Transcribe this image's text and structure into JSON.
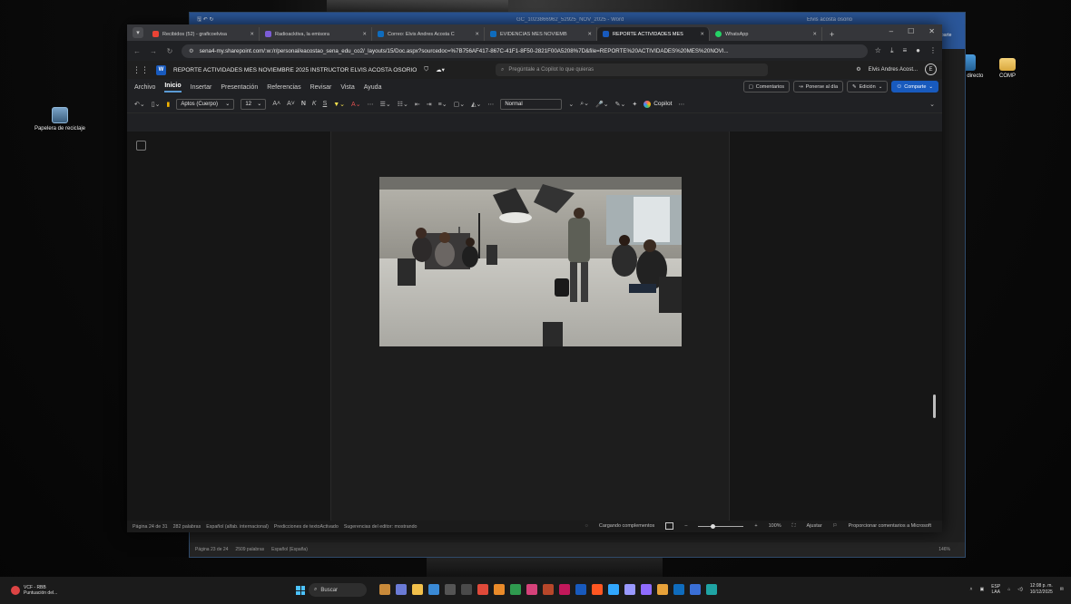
{
  "desktop": {
    "icons": [
      {
        "label": "Papelera de reciclaje"
      },
      {
        "label": "COMP"
      },
      {
        "label": "uipo - directo"
      }
    ]
  },
  "back_window": {
    "title": "GC_1023866962_52925_NOV_2025 - Word",
    "user": "Elvis acosta osorio",
    "status": [
      "Página 23 de 24",
      "2509 palabras",
      "Español (España)"
    ],
    "zoom": "146%",
    "share_fragment": "parte"
  },
  "browser": {
    "tabs": [
      {
        "label": "Recibidos (52) - graficoelvisa",
        "color": "#ea4335"
      },
      {
        "label": "Radioacktiva, la emisora",
        "color": "#7b5cd6"
      },
      {
        "label": "Correo: Elvis Andres Acosta C",
        "color": "#0f6cbd"
      },
      {
        "label": "EVIDENCIAS MES NOVIEMB",
        "color": "#0f6cbd"
      },
      {
        "label": "REPORTE ACTIVIDADES MES",
        "color": "#185abd",
        "active": true
      },
      {
        "label": "WhatsApp",
        "color": "#25d366"
      }
    ],
    "url_host": "sena4-my.sharepoint.com",
    "url": "sena4-my.sharepoint.com/:w:/r/personal/eacostao_sena_edu_co2/_layouts/15/Doc.aspx?sourcedoc=%7B756AF417-867C-41F1-8F50-2821F00A5208%7D&file=REPORTE%20ACTIVIDADES%20MES%20NOVI..."
  },
  "word": {
    "doc_title": "REPORTE ACTIVIDADES MES NOVIEMBRE 2025 INSTRUCTOR ELVIS ACOSTA OSORIO",
    "search_placeholder": "Pregúntale a Copilot lo que quieras",
    "user_name": "Elvis Andres Acost...",
    "user_initial": "E",
    "menu": [
      "Archivo",
      "Inicio",
      "Insertar",
      "Presentación",
      "Referencias",
      "Revisar",
      "Vista",
      "Ayuda"
    ],
    "ribbon_buttons": {
      "comments": "Comentarios",
      "catch_up": "Ponerse al día",
      "editing": "Edición",
      "share": "Comparte"
    },
    "toolbar": {
      "font": "Aptos (Cuerpo)",
      "size": "12",
      "style": "Normal",
      "copilot": "Copilot"
    },
    "status": {
      "page": "Página 24 de 31",
      "words": "282 palabras",
      "language": "Español (alfab. internacional)",
      "predictions": "Predicciones de textoActivado",
      "suggestions": "Sugerencias del editor: mostrando",
      "loading": "Cargando complementos",
      "zoom": "100%",
      "fit": "Ajustar",
      "feedback": "Proporcionar comentarios a Microsoft"
    }
  },
  "taskbar": {
    "weather": "VCF - RBB",
    "weather_sub": "Puntuación del...",
    "search": "Buscar",
    "lang": "ESP",
    "lang_sub": "LAA",
    "time": "12:08 p. m.",
    "date": "10/12/2025"
  },
  "colors": {
    "word_blue": "#185abd",
    "accent": "#5b9bd5"
  }
}
